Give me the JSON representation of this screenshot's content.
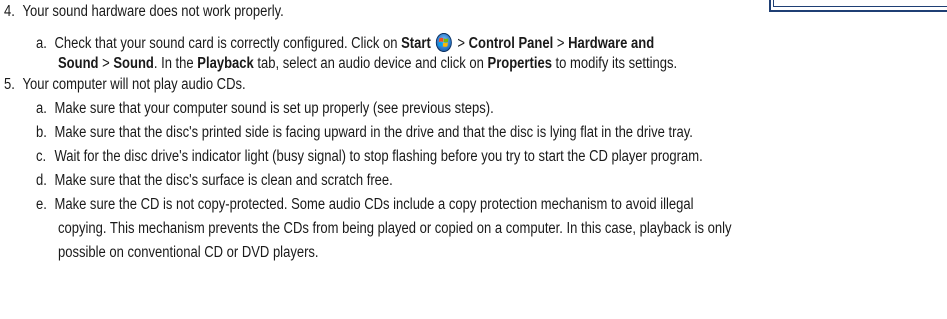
{
  "item4": {
    "number": "4.",
    "text": "Your sound hardware does not work properly.",
    "a": {
      "letter": "a.",
      "t1": "Check that your sound card is correctly configured. Click on ",
      "start": "Start",
      "gt1": " > ",
      "control_panel": "Control Panel",
      "gt2": " > ",
      "hardware_and": "Hardware and",
      "sound1": "Sound",
      "gt3": " > ",
      "sound2": "Sound",
      "t2": ". In the ",
      "playback": "Playback",
      "t3": " tab, select an audio device and click on ",
      "properties": "Properties",
      "t4": " to modify its settings."
    }
  },
  "item5": {
    "number": "5.",
    "text": "Your computer will not play audio CDs.",
    "a": {
      "letter": "a.",
      "text": "Make sure that your computer sound is set up properly (see previous steps)."
    },
    "b": {
      "letter": "b.",
      "text": "Make sure that the disc's printed side is facing upward in the drive and that the disc is lying flat in the drive tray."
    },
    "c": {
      "letter": "c.",
      "text": "Wait for the disc drive's indicator light (busy signal) to stop flashing before you try to start the CD player program."
    },
    "d": {
      "letter": "d.",
      "text": "Make sure that the disc's surface is clean and scratch free."
    },
    "e": {
      "letter": "e.",
      "line1": "Make sure the CD is not copy-protected. Some audio CDs include a copy protection mechanism to avoid illegal",
      "line2": "copying. This mechanism prevents the CDs from being played or copied on a computer. In this case, playback is only",
      "line3": "possible on conventional CD or DVD players."
    }
  },
  "icons": {
    "start": "windows-start-orb-icon"
  },
  "colors": {
    "box_border": "#1f3f74",
    "text": "#1a1a1a"
  }
}
